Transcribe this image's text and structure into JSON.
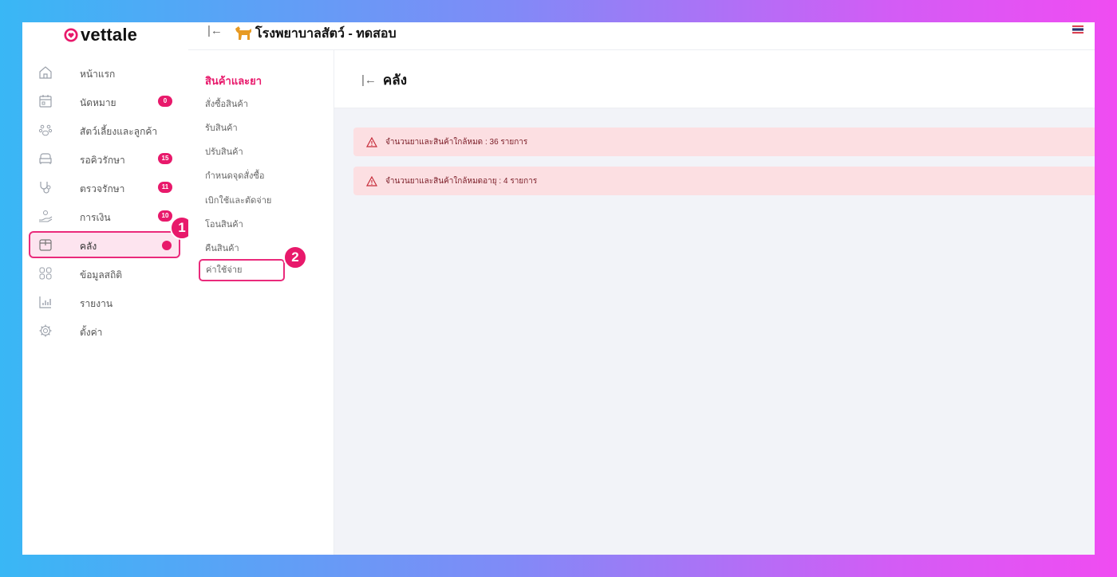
{
  "app": {
    "logo_text": "vettale",
    "clinic_name": "โรงพยาบาลสัตว์ - ทดสอบ"
  },
  "sidebar": {
    "items": [
      {
        "label": "หน้าแรก",
        "icon": "home-icon"
      },
      {
        "label": "นัดหมาย",
        "icon": "calendar-icon",
        "badge": "0"
      },
      {
        "label": "สัตว์เลี้ยงและลูกค้า",
        "icon": "paw-icon"
      },
      {
        "label": "รอคิวรักษา",
        "icon": "couch-icon",
        "badge": "15"
      },
      {
        "label": "ตรวจรักษา",
        "icon": "stethoscope-icon",
        "badge": "11"
      },
      {
        "label": "การเงิน",
        "icon": "coin-hand-icon",
        "badge": "10"
      },
      {
        "label": "คลัง",
        "icon": "box-icon",
        "active": true
      },
      {
        "label": "ข้อมูลสถิติ",
        "icon": "grid-icon"
      },
      {
        "label": "รายงาน",
        "icon": "bar-chart-icon"
      },
      {
        "label": "ตั้งค่า",
        "icon": "gear-icon"
      }
    ]
  },
  "callouts": {
    "one": "1",
    "two": "2"
  },
  "submenu": {
    "items": [
      {
        "label": "สินค้าและยา",
        "active": true
      },
      {
        "label": "สั่งซื้อสินค้า"
      },
      {
        "label": "รับสินค้า"
      },
      {
        "label": "ปรับสินค้า"
      },
      {
        "label": "กำหนดจุดสั่งซื้อ"
      },
      {
        "label": "เบิกใช้และตัดจ่าย"
      },
      {
        "label": "โอนสินค้า"
      },
      {
        "label": "คืนสินค้า"
      },
      {
        "label": "ค่าใช้จ่าย",
        "highlighted": true
      }
    ]
  },
  "main": {
    "title": "คลัง",
    "alerts": [
      {
        "text": "จำนวนยาและสินค้าใกล้หมด : 36 รายการ"
      },
      {
        "text": "จำนวนยาและสินค้าใกล้หมดอายุ : 4 รายการ"
      }
    ]
  },
  "colors": {
    "accent": "#e8196b",
    "alert_bg": "#fcdfe2"
  }
}
